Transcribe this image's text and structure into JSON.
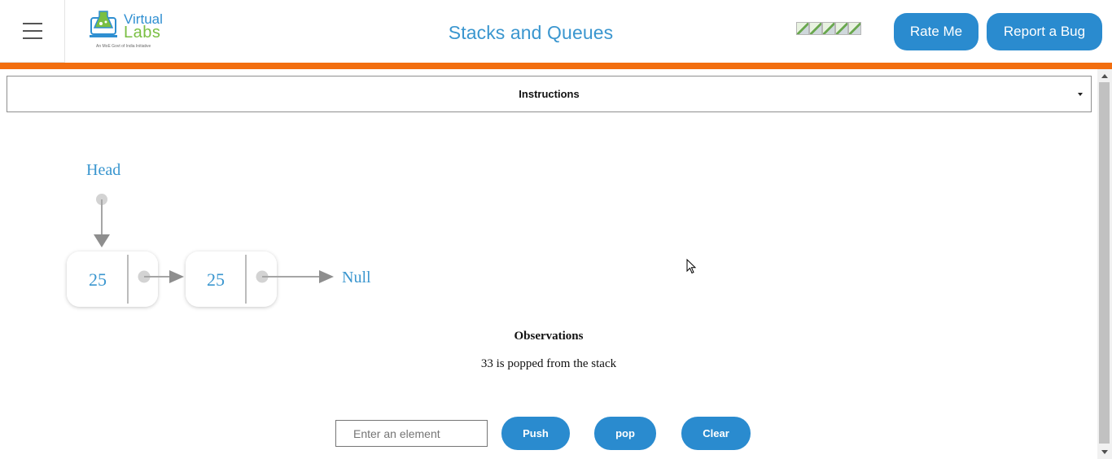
{
  "header": {
    "menu_icon": "hamburger-menu-icon",
    "logo": {
      "text_line1": "Virtual",
      "text_line2": "Labs",
      "tagline": "An MoE Govt of India Initiative"
    },
    "title": "Stacks and Queues",
    "rating_icon": "broken-image-icon",
    "rating_count": 5,
    "rate_button": "Rate Me",
    "bug_button": "Report a Bug"
  },
  "colors": {
    "accent_blue": "#2a8bcf",
    "title_blue": "#3a96cf",
    "orange_bar": "#f26e0f"
  },
  "instructions": {
    "label": "Instructions",
    "caret_icon": "caret-down-icon"
  },
  "diagram": {
    "head_label": "Head",
    "null_label": "Null",
    "nodes": [
      {
        "value": "25"
      },
      {
        "value": "25"
      }
    ]
  },
  "observations": {
    "title": "Observations",
    "message": "33 is popped from the stack"
  },
  "controls": {
    "input_placeholder": "Enter an element",
    "input_value": "",
    "push_label": "Push",
    "pop_label": "pop",
    "clear_label": "Clear"
  }
}
